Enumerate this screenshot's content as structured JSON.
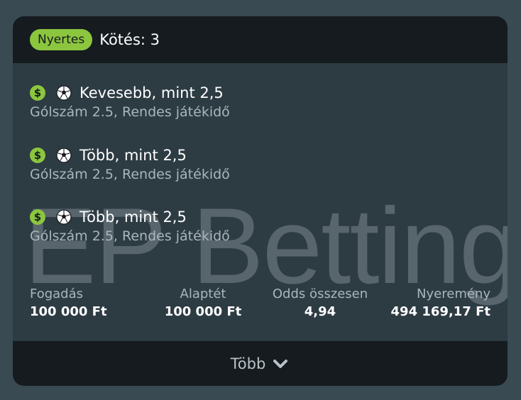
{
  "header": {
    "status": "Nyertes",
    "bet_count": "Kötés: 3"
  },
  "colors": {
    "accent_green": "#8cc63f",
    "header_bg": "#151b1f",
    "card_bg": "#2d3b43",
    "page_bg": "#3a4a52"
  },
  "watermark": "EP Betting",
  "selections": [
    {
      "icons": [
        "dollar-icon",
        "soccer-ball-icon"
      ],
      "name": "Kevesebb, mint 2,5",
      "market": "Gólszám 2.5, Rendes játékidő"
    },
    {
      "icons": [
        "dollar-icon",
        "soccer-ball-icon"
      ],
      "name": "Több, mint 2,5",
      "market": "Gólszám 2.5, Rendes játékidő"
    },
    {
      "icons": [
        "dollar-icon",
        "soccer-ball-icon"
      ],
      "name": "Több, mint 2,5",
      "market": "Gólszám 2.5, Rendes játékidő"
    }
  ],
  "summary": {
    "stake_label": "Fogadás",
    "stake_value": "100 000 Ft",
    "base_stake_label": "Alaptét",
    "base_stake_value": "100 000 Ft",
    "total_odds_label": "Odds összesen",
    "total_odds_value": "4,94",
    "winnings_label": "Nyeremény",
    "winnings_value": "494 169,17 Ft"
  },
  "footer": {
    "more_label": "Több"
  }
}
